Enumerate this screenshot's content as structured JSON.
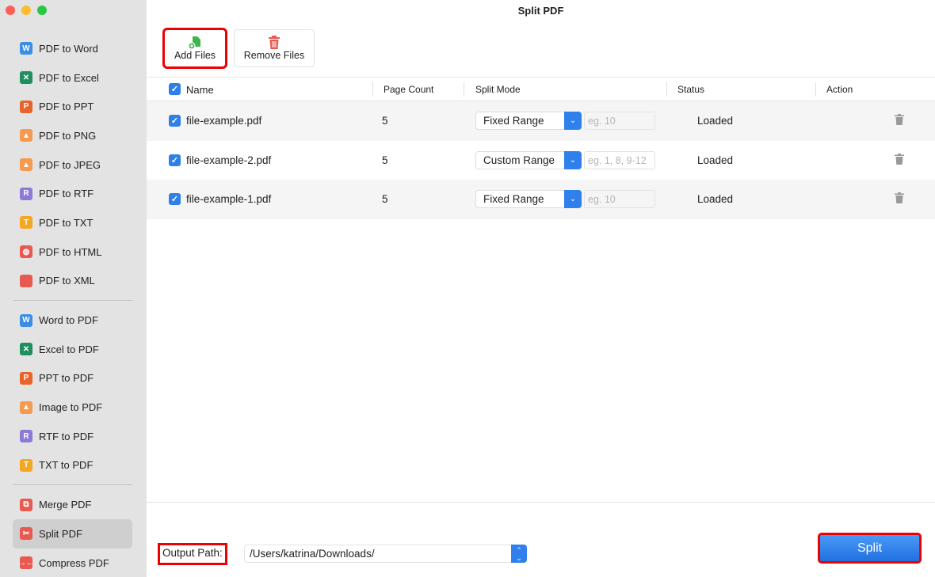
{
  "window": {
    "title": "Split PDF"
  },
  "colors": {
    "accent": "#2f80ed",
    "highlight": "#ee0000"
  },
  "sidebar": {
    "groups": [
      [
        {
          "label": "PDF to Word",
          "icon": "word-icon",
          "glyph": "W",
          "color": "#3a8ee6"
        },
        {
          "label": "PDF to Excel",
          "icon": "excel-icon",
          "glyph": "✕",
          "color": "#1f8f5f"
        },
        {
          "label": "PDF to PPT",
          "icon": "ppt-icon",
          "glyph": "P",
          "color": "#e8642c"
        },
        {
          "label": "PDF to PNG",
          "icon": "image-icon",
          "glyph": "▲",
          "color": "#f59a4e"
        },
        {
          "label": "PDF to JPEG",
          "icon": "image-icon",
          "glyph": "▲",
          "color": "#f59a4e"
        },
        {
          "label": "PDF to RTF",
          "icon": "rtf-icon",
          "glyph": "R",
          "color": "#8e7ad6"
        },
        {
          "label": "PDF to TXT",
          "icon": "txt-icon",
          "glyph": "T",
          "color": "#f5a623"
        },
        {
          "label": "PDF to HTML",
          "icon": "globe-icon",
          "glyph": "◍",
          "color": "#e85a50"
        },
        {
          "label": "PDF to XML",
          "icon": "code-icon",
          "glyph": "</>",
          "color": "#e85a50"
        }
      ],
      [
        {
          "label": "Word to PDF",
          "icon": "word-icon",
          "glyph": "W",
          "color": "#3a8ee6"
        },
        {
          "label": "Excel to PDF",
          "icon": "excel-icon",
          "glyph": "✕",
          "color": "#1f8f5f"
        },
        {
          "label": "PPT to PDF",
          "icon": "ppt-icon",
          "glyph": "P",
          "color": "#e8642c"
        },
        {
          "label": "Image to PDF",
          "icon": "image-icon",
          "glyph": "▲",
          "color": "#f59a4e"
        },
        {
          "label": "RTF to PDF",
          "icon": "rtf-icon",
          "glyph": "R",
          "color": "#8e7ad6"
        },
        {
          "label": "TXT to PDF",
          "icon": "txt-icon",
          "glyph": "T",
          "color": "#f5a623"
        }
      ],
      [
        {
          "label": "Merge PDF",
          "icon": "merge-icon",
          "glyph": "⧉",
          "color": "#e85a50"
        },
        {
          "label": "Split PDF",
          "icon": "scissors-icon",
          "glyph": "✂",
          "color": "#e85a50",
          "active": true
        },
        {
          "label": "Compress PDF",
          "icon": "compress-icon",
          "glyph": "→←",
          "color": "#e85a50"
        }
      ]
    ]
  },
  "toolbar": {
    "add_files": "Add Files",
    "remove_files": "Remove Files"
  },
  "table": {
    "headers": {
      "name": "Name",
      "page_count": "Page Count",
      "split_mode": "Split Mode",
      "status": "Status",
      "action": "Action"
    },
    "rows": [
      {
        "name": "file-example.pdf",
        "pages": "5",
        "mode": "Fixed Range",
        "placeholder": "eg. 10",
        "status": "Loaded",
        "checked": true
      },
      {
        "name": "file-example-2.pdf",
        "pages": "5",
        "mode": "Custom Range",
        "placeholder": "eg. 1, 8, 9-12",
        "status": "Loaded",
        "checked": true
      },
      {
        "name": "file-example-1.pdf",
        "pages": "5",
        "mode": "Fixed Range",
        "placeholder": "eg. 10",
        "status": "Loaded",
        "checked": true
      }
    ]
  },
  "footer": {
    "output_label": "Output Path:",
    "output_path": "/Users/katrina/Downloads/",
    "split_label": "Split"
  }
}
